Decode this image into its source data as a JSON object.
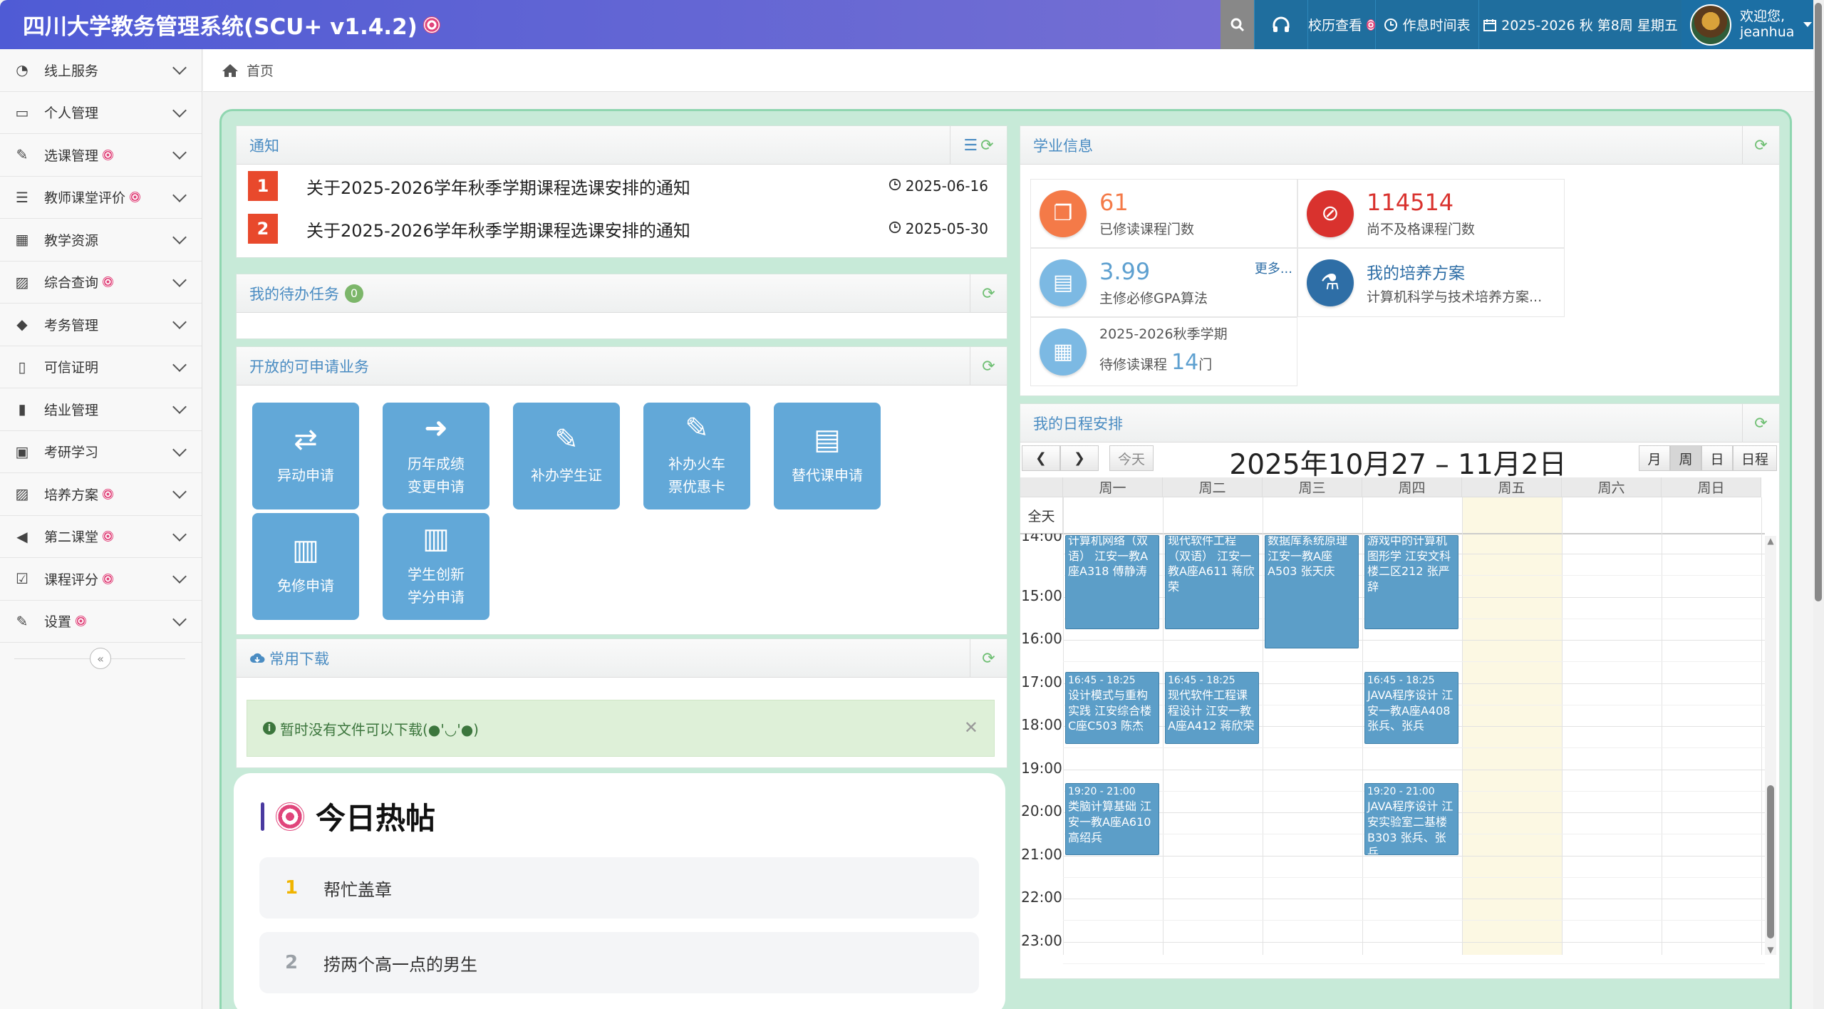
{
  "header": {
    "title": "四川大学教务管理系统(SCU+ v1.4.2)",
    "calendar_link": "校历查看",
    "timetable_link": "作息时间表",
    "term_info": "2025-2026 秋 第8周 星期五",
    "welcome": "欢迎您,",
    "username": "jeanhua"
  },
  "sidebar": {
    "items": [
      {
        "label": "线上服务",
        "icon": "dashboard-icon",
        "glyph": "◔",
        "badge": false
      },
      {
        "label": "个人管理",
        "icon": "monitor-icon",
        "glyph": "▭",
        "badge": false
      },
      {
        "label": "选课管理",
        "icon": "edit-icon",
        "glyph": "✎",
        "badge": true
      },
      {
        "label": "教师课堂评价",
        "icon": "list-icon",
        "glyph": "☰",
        "badge": true
      },
      {
        "label": "教学资源",
        "icon": "calendar-icon",
        "glyph": "▦",
        "badge": false
      },
      {
        "label": "综合查询",
        "icon": "picture-icon",
        "glyph": "▨",
        "badge": true
      },
      {
        "label": "考务管理",
        "icon": "tag-icon",
        "glyph": "◆",
        "badge": false
      },
      {
        "label": "可信证明",
        "icon": "file-icon",
        "glyph": "▯",
        "badge": false
      },
      {
        "label": "结业管理",
        "icon": "file-text-icon",
        "glyph": "▮",
        "badge": false
      },
      {
        "label": "考研学习",
        "icon": "qrcode-icon",
        "glyph": "▣",
        "badge": false
      },
      {
        "label": "培养方案",
        "icon": "picture-icon",
        "glyph": "▨",
        "badge": true
      },
      {
        "label": "第二课堂",
        "icon": "bullhorn-icon",
        "glyph": "◀",
        "badge": true
      },
      {
        "label": "课程评分",
        "icon": "check-square-icon",
        "glyph": "☑",
        "badge": true
      },
      {
        "label": "设置",
        "icon": "edit-icon",
        "glyph": "✎",
        "badge": true
      }
    ]
  },
  "breadcrumb": {
    "home": "首页"
  },
  "notices": {
    "title": "通知",
    "items": [
      {
        "rank": "1",
        "title": "关于2025-2026学年秋季学期课程选课安排的通知",
        "date": "2025-06-16",
        "color": "#e8492c"
      },
      {
        "rank": "2",
        "title": "关于2025-2026学年秋季学期课程选课安排的通知",
        "date": "2025-05-30",
        "color": "#e8492c"
      }
    ]
  },
  "todo": {
    "title": "我的待办任务",
    "count": "0"
  },
  "services": {
    "title": "开放的可申请业务",
    "items": [
      {
        "line1": "异动申请",
        "line2": "",
        "icon": "exchange-icon",
        "glyph": "⇄"
      },
      {
        "line1": "历年成绩",
        "line2": "变更申请",
        "icon": "sign-out-icon",
        "glyph": "➜"
      },
      {
        "line1": "补办学生证",
        "line2": "",
        "icon": "edit-icon",
        "glyph": "✎"
      },
      {
        "line1": "补办火车",
        "line2": "票优惠卡",
        "icon": "edit-icon",
        "glyph": "✎"
      },
      {
        "line1": "替代课申请",
        "line2": "",
        "icon": "book-icon",
        "glyph": "▤"
      },
      {
        "line1": "免修申请",
        "line2": "",
        "icon": "books-icon",
        "glyph": "▥"
      },
      {
        "line1": "学生创新",
        "line2": "学分申请",
        "icon": "books-icon",
        "glyph": "▥"
      }
    ]
  },
  "downloads": {
    "title": "常用下载",
    "empty": "暂时没有文件可以下载(●'◡'●)"
  },
  "hot": {
    "title": "今日热帖",
    "items": [
      {
        "rank": "1",
        "title": "帮忙盖章",
        "color": "#f0b400"
      },
      {
        "rank": "2",
        "title": "捞两个高一点的男生",
        "color": "#9aa0a6"
      }
    ]
  },
  "academic": {
    "title": "学业信息",
    "completed": {
      "value": "61",
      "label": "已修读课程门数",
      "color": "#f47a48"
    },
    "failed": {
      "value": "114514",
      "label": "尚不及格课程门数",
      "color": "#d9322e"
    },
    "gpa": {
      "value": "3.99",
      "label": "主修必修GPA算法",
      "more": "更多...",
      "color": "#5ea0d0"
    },
    "plan": {
      "title": "我的培养方案",
      "desc": "计算机科学与技术培养方案...",
      "color": "#2e6ea6"
    },
    "pending": {
      "term": "2025-2026秋季学期",
      "prefix": "待修读课程",
      "count": "14",
      "unit": "门"
    }
  },
  "schedule": {
    "title": "我的日程安排",
    "range": "2025年10月27 – 11月2日",
    "today": "今天",
    "views": [
      "月",
      "周",
      "日",
      "日程"
    ],
    "active_view": "周",
    "allday": "全天",
    "days": [
      "周一",
      "周二",
      "周三",
      "周四",
      "周五",
      "周六",
      "周日"
    ],
    "hours": [
      "14:00",
      "15:00",
      "16:00",
      "17:00",
      "18:00",
      "19:00",
      "20:00",
      "21:00",
      "22:00",
      "23:00"
    ],
    "today_day": "周五",
    "events": [
      {
        "day": 0,
        "start": 14,
        "end": 15.75,
        "time": "",
        "text": "计算机网络（双语） 江安一教A座A318 傅静涛"
      },
      {
        "day": 1,
        "start": 14,
        "end": 15.75,
        "time": "",
        "text": "现代软件工程（双语） 江安一教A座A611 蒋欣荣"
      },
      {
        "day": 2,
        "start": 14,
        "end": 16.2,
        "time": "",
        "text": "数据库系统原理 江安一教A座A503 张天庆"
      },
      {
        "day": 3,
        "start": 14,
        "end": 15.75,
        "time": "",
        "text": "游戏中的计算机图形学 江安文科楼二区212 张严辞"
      },
      {
        "day": 0,
        "start": 16.75,
        "end": 18.42,
        "time": "16:45 - 18:25",
        "text": "设计模式与重构实践 江安综合楼C座C503 陈杰"
      },
      {
        "day": 1,
        "start": 16.75,
        "end": 18.42,
        "time": "16:45 - 18:25",
        "text": "现代软件工程课程设计 江安一教A座A412 蒋欣荣"
      },
      {
        "day": 3,
        "start": 16.75,
        "end": 18.42,
        "time": "16:45 - 18:25",
        "text": "JAVA程序设计 江安一教A座A408 张兵、张兵"
      },
      {
        "day": 0,
        "start": 19.33,
        "end": 21,
        "time": "19:20 - 21:00",
        "text": "类脑计算基础 江安一教A座A610 高绍兵"
      },
      {
        "day": 3,
        "start": 19.33,
        "end": 21,
        "time": "19:20 - 21:00",
        "text": "JAVA程序设计 江安实验室二基楼B303 张兵、张兵"
      }
    ]
  }
}
